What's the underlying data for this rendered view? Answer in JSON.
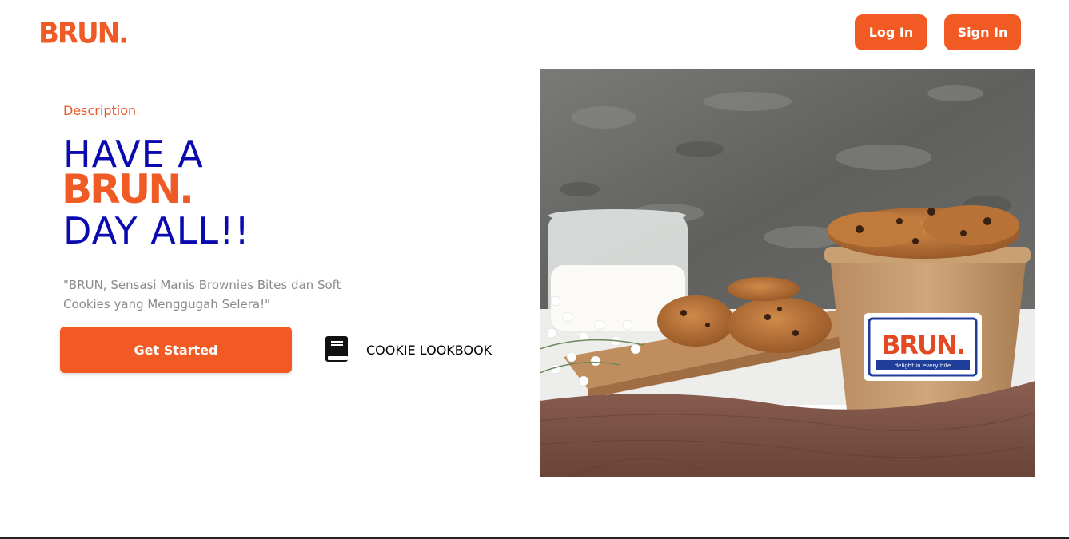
{
  "header": {
    "logo": "BRUN.",
    "login_label": "Log In",
    "signin_label": "Sign In"
  },
  "hero": {
    "description_label": "Description",
    "line1": "HAVE A",
    "brand": "BRUN.",
    "line3": "DAY ALL!!",
    "quote": "\"BRUN, Sensasi Manis Brownies Bites dan Soft Cookies yang Menggugah Selera!\"",
    "get_started_label": "Get Started",
    "lookbook_label": "COOKIE LOOKBOOK",
    "lookbook_icon": "book-icon"
  },
  "product_image": {
    "cup_label": "BRUN.",
    "cup_tagline": "delight in every bite"
  },
  "colors": {
    "accent": "#f25a24",
    "heading_blue": "#0a0ab0",
    "quote_gray": "#8a8a8a"
  }
}
